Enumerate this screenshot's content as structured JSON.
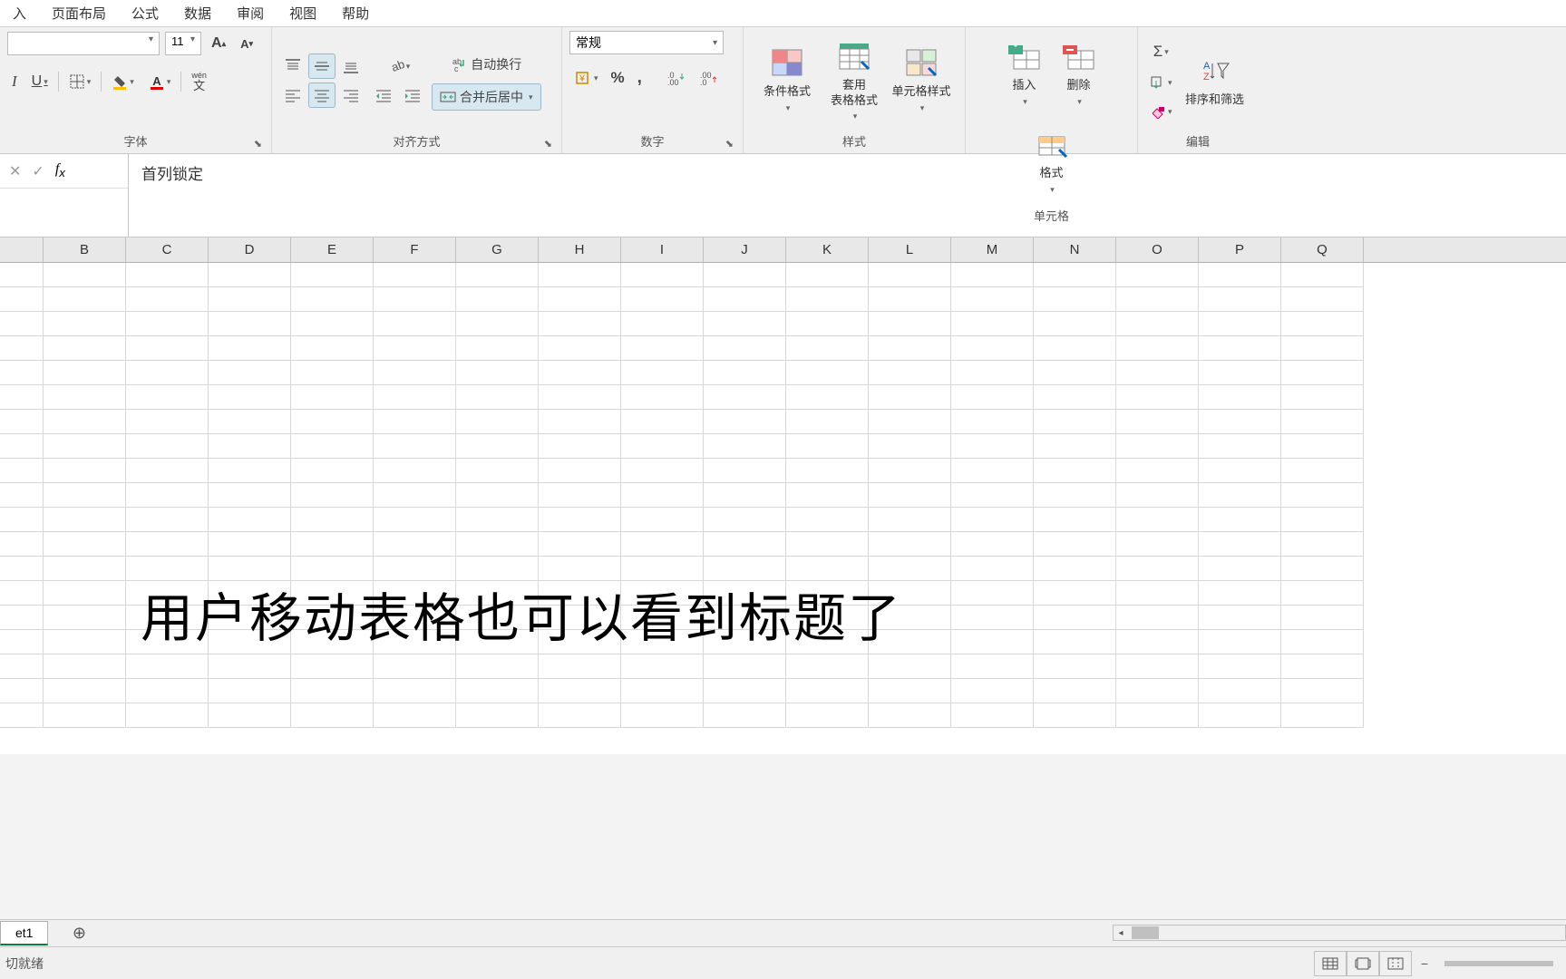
{
  "tabs": {
    "insert": "入",
    "layout": "页面布局",
    "formula": "公式",
    "data": "数据",
    "review": "审阅",
    "view": "视图",
    "help": "帮助"
  },
  "font": {
    "size": "11",
    "group_label": "字体"
  },
  "align": {
    "wrap": "自动换行",
    "merge": "合并后居中",
    "group_label": "对齐方式"
  },
  "number": {
    "format": "常规",
    "group_label": "数字"
  },
  "styles": {
    "cond": "条件格式",
    "table": "套用\n表格格式",
    "cell": "单元格样式",
    "group_label": "样式"
  },
  "cells": {
    "insert": "插入",
    "delete": "删除",
    "format": "格式",
    "group_label": "单元格"
  },
  "editing": {
    "sort": "排序和筛选",
    "group_label": "编辑"
  },
  "formula_bar": {
    "content": "首列锁定"
  },
  "columns": [
    "",
    "B",
    "C",
    "D",
    "E",
    "F",
    "G",
    "H",
    "I",
    "J",
    "K",
    "L",
    "M",
    "N",
    "O",
    "P",
    "Q"
  ],
  "overlay": "用户移动表格也可以看到标题了",
  "sheet": {
    "name": "et1"
  },
  "status": {
    "ready": "切就绪"
  },
  "icons": {
    "pinyin": "wén",
    "pinyin2": "文"
  }
}
